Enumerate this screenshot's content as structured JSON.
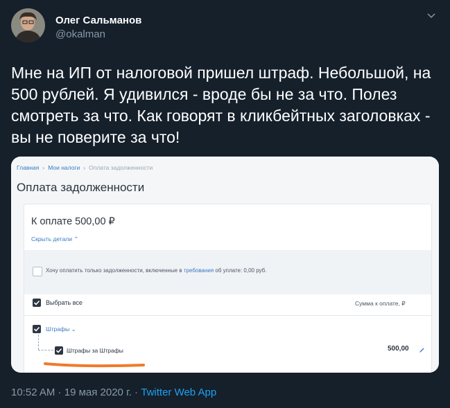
{
  "author": {
    "name": "Олег Сальманов",
    "handle": "@okalman"
  },
  "tweet": {
    "text": "Мне на ИП от налоговой пришел штраф. Небольшой, на 500 рублей. Я удивился - вроде бы не за что. Полез смотреть за что. Как говорят в кликбейтных заголовках - вы не поверите за что!"
  },
  "screenshot": {
    "breadcrumb": [
      "Главная",
      "Мои налоги",
      "Оплата задолженности"
    ],
    "page_title": "Оплата задолженности",
    "pay_amount": "К оплате 500,00 ₽",
    "hide_details": "Скрыть детали ⌃",
    "only_debts_prefix": "Хочу оплатить только задолженности, включенные в ",
    "only_debts_link": "требования",
    "only_debts_suffix": " об уплате: 0,00 руб.",
    "select_all": "Выбрать все",
    "sum_header": "Сумма к оплате, ₽",
    "fines_group": "Штрафы ⌄",
    "fine_item": "Штрафы за Штрафы",
    "fine_amount": "500,00"
  },
  "footer": {
    "time": "10:52 AM",
    "separator": " · ",
    "date": "19 мая 2020 г.",
    "source": "Twitter Web App"
  },
  "colors": {
    "background": "#15202b",
    "secondary_text": "#8899a6",
    "link": "#1da1f2",
    "highlight_mark": "#f07a2a"
  },
  "icons": [
    "chevron-down-icon",
    "checkbox-checked-icon",
    "checkbox-empty-icon",
    "pencil-icon"
  ]
}
